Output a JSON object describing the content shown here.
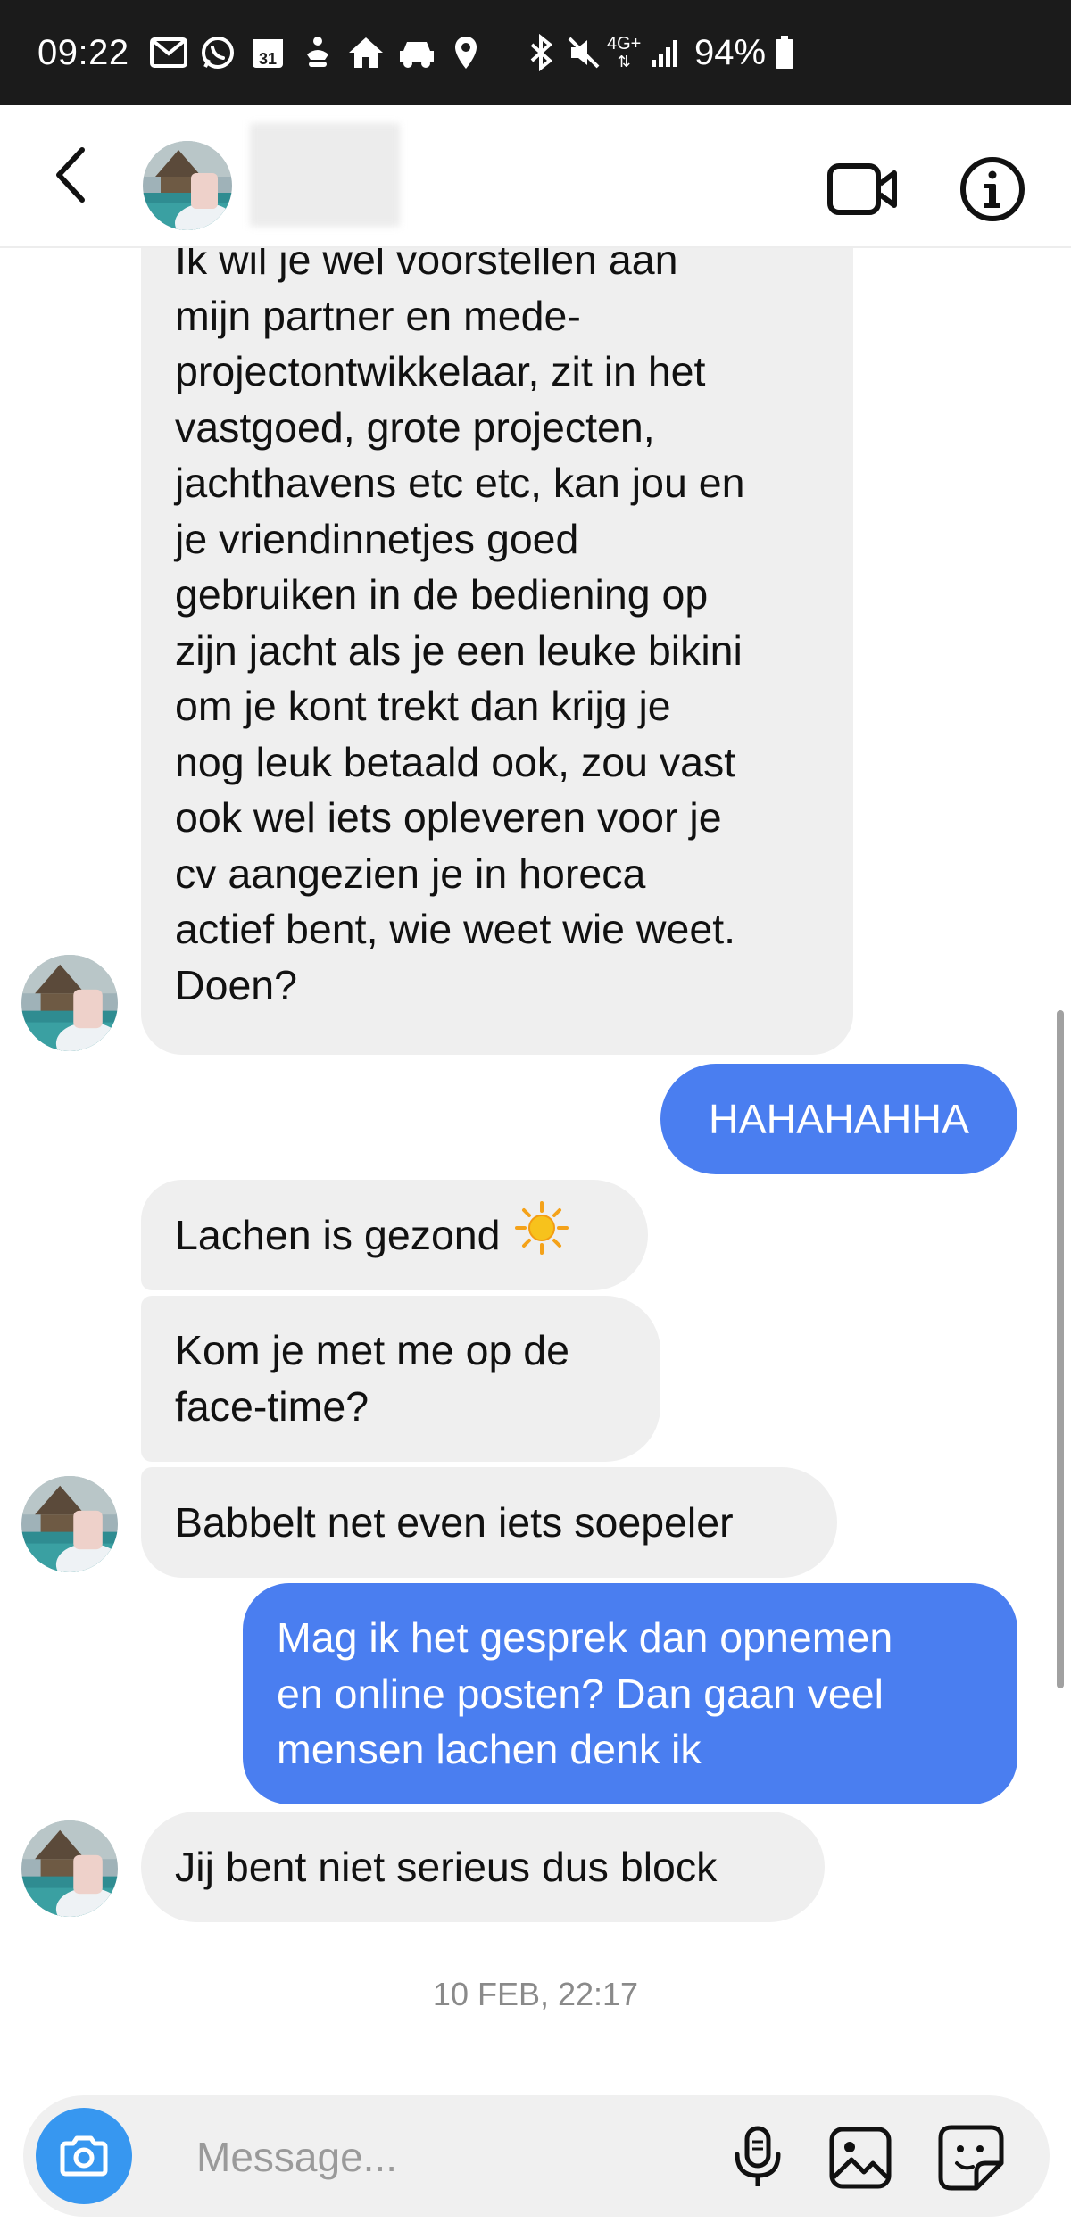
{
  "status_bar": {
    "time": "09:22",
    "network": "4G+",
    "battery": "94%"
  },
  "header": {
    "contact_name": "",
    "icons": [
      "back-arrow-icon",
      "video-call-icon",
      "info-icon"
    ]
  },
  "conversation": {
    "messages": [
      {
        "from": "contact",
        "lines": [
          "Ik wil je wel voorstellen aan",
          "mijn partner en mede-",
          "projectontwikkelaar, zit in het",
          "vastgoed, grote projecten,",
          "jachthavens etc etc, kan jou en",
          "je vriendinnetjes goed",
          "gebruiken in de bediening op",
          "zijn jacht als je een leuke bikini",
          "om je kont trekt dan krijg je",
          "nog leuk betaald ook, zou vast",
          "ook wel iets opleveren voor je",
          "cv aangezien je in horeca",
          "actief bent, wie weet wie weet.",
          "Doen?"
        ]
      },
      {
        "from": "me",
        "lines": [
          "HAHAHAHHA"
        ]
      },
      {
        "from": "contact",
        "lines": [
          "Lachen is gezond"
        ],
        "emoji": "sun-emoji-icon"
      },
      {
        "from": "contact",
        "lines": [
          "Kom je met me op de",
          "face-time?"
        ]
      },
      {
        "from": "contact",
        "lines": [
          "Babbelt net even iets soepeler"
        ]
      },
      {
        "from": "me",
        "lines": [
          "Mag ik het gesprek dan opnemen",
          "en online posten? Dan gaan veel",
          "mensen lachen denk ik"
        ]
      },
      {
        "from": "contact",
        "lines": [
          "Jij bent niet serieus dus block"
        ]
      }
    ],
    "timestamp": "10 FEB, 22:17"
  },
  "composer": {
    "placeholder": "Message...",
    "icons": [
      "camera-icon",
      "microphone-icon",
      "gallery-icon",
      "sticker-icon"
    ]
  },
  "colors": {
    "status_bar_bg": "#1b1b1b",
    "incoming_bubble": "#efefef",
    "outgoing_bubble": "#4a7ef0",
    "camera_button": "#3797f0",
    "text_muted": "#8a8a8a"
  }
}
